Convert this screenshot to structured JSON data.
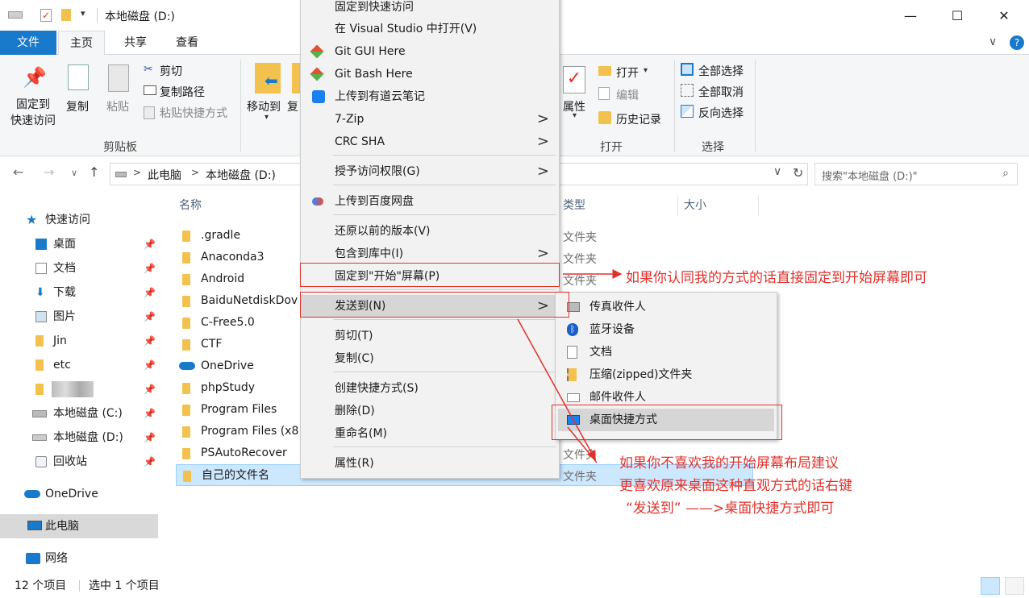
{
  "window": {
    "title": "本地磁盘 (D:)"
  },
  "tabs": {
    "file": "文件",
    "home": "主页",
    "share": "共享",
    "view": "查看"
  },
  "ribbon": {
    "pin_quick_access": "固定到\n快速访问",
    "copy": "复制",
    "paste": "粘贴",
    "cut": "剪切",
    "copy_path": "复制路径",
    "paste_shortcut": "粘贴快捷方式",
    "clipboard_group": "剪贴板",
    "move_to": "移动到",
    "copy_to": "复",
    "properties": "属性",
    "open": "打开",
    "edit": "编辑",
    "history": "历史记录",
    "open_group": "打开",
    "select_all": "全部选择",
    "select_none": "全部取消",
    "invert_selection": "反向选择",
    "select_group": "选择"
  },
  "address": {
    "segments": [
      "此电脑",
      "本地磁盘 (D:)"
    ],
    "search_placeholder": "搜索\"本地磁盘 (D:)\""
  },
  "sidebar": {
    "quick_access": "快速访问",
    "items": [
      "桌面",
      "文档",
      "下载",
      "图片",
      "Jin",
      "etc",
      "",
      "本地磁盘 (C:)",
      "本地磁盘 (D:)",
      "回收站"
    ],
    "onedrive": "OneDrive",
    "this_pc": "此电脑",
    "network": "网络"
  },
  "columns": {
    "name": "名称",
    "type": "类型",
    "size": "大小"
  },
  "files": [
    {
      "name": ".gradle",
      "type": "文件夹"
    },
    {
      "name": "Anaconda3",
      "type": "文件夹"
    },
    {
      "name": "Android",
      "type": "文件夹"
    },
    {
      "name": "BaiduNetdiskDov",
      "type": ""
    },
    {
      "name": "C-Free5.0",
      "type": ""
    },
    {
      "name": "CTF",
      "type": ""
    },
    {
      "name": "OneDrive",
      "type": ""
    },
    {
      "name": "phpStudy",
      "type": ""
    },
    {
      "name": "Program Files",
      "type": ""
    },
    {
      "name": "Program Files (x8",
      "type": ""
    },
    {
      "name": "PSAutoRecover",
      "type": "文件夹"
    },
    {
      "name": "自己的文件名",
      "type": "文件夹"
    }
  ],
  "context_menu": {
    "items": [
      "固定到快速访问",
      "在 Visual Studio 中打开(V)",
      "Git GUI Here",
      "Git Bash Here",
      "上传到有道云笔记",
      "7-Zip",
      "CRC SHA",
      "授予访问权限(G)",
      "上传到百度网盘",
      "还原以前的版本(V)",
      "包含到库中(I)",
      "固定到\"开始\"屏幕(P)",
      "发送到(N)",
      "剪切(T)",
      "复制(C)",
      "创建快捷方式(S)",
      "删除(D)",
      "重命名(M)",
      "属性(R)"
    ]
  },
  "sendto_menu": {
    "items": [
      "传真收件人",
      "蓝牙设备",
      "文档",
      "压缩(zipped)文件夹",
      "邮件收件人",
      "桌面快捷方式"
    ]
  },
  "annotations": {
    "a1": "如果你认同我的方式的话直接固定到开始屏幕即可",
    "a2_l1": "如果你不喜欢我的开始屏幕布局建议",
    "a2_l2": "更喜欢原来桌面这种直观方式的话右键",
    "a2_l3": "“发送到”  ——>桌面快捷方式即可"
  },
  "status": {
    "count": "12 个项目",
    "selected": "选中 1 个项目"
  }
}
